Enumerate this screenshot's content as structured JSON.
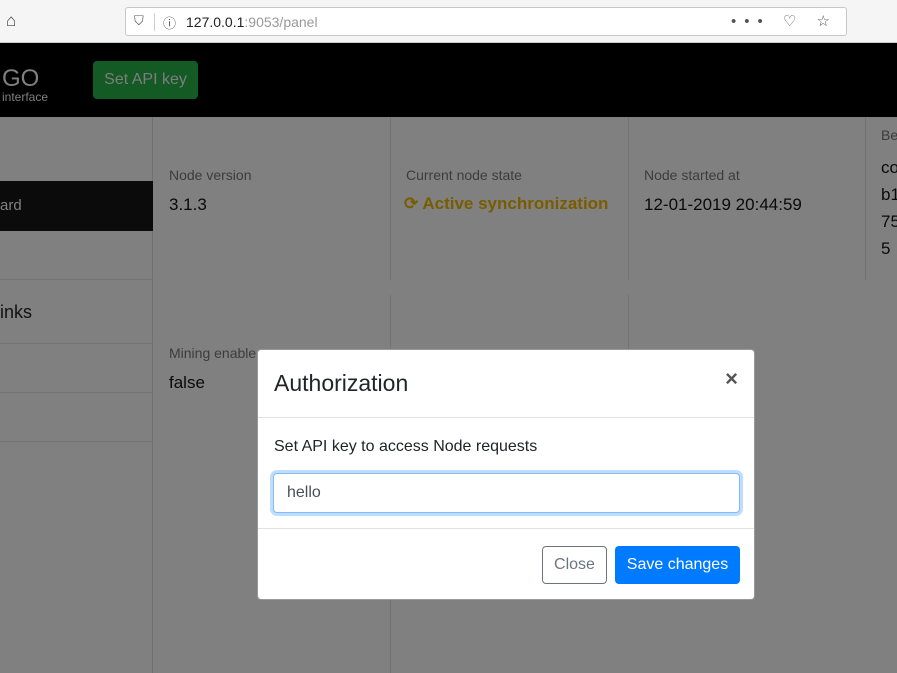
{
  "browser": {
    "url_host": "127.0.0.1",
    "url_rest": ":9053/panel",
    "actions": "••• ♡ ☆"
  },
  "header": {
    "logo": "GO",
    "logo_sub": "interface",
    "api_button": "Set API key"
  },
  "sidebar": {
    "active_item": "ard",
    "links_heading": "inks"
  },
  "stats": [
    {
      "label": "Node version",
      "value": "3.1.3"
    },
    {
      "label": "Current node state",
      "value": "Active synchronization",
      "color": "#7a5c00"
    },
    {
      "label": "Node started at",
      "value": "12-01-2019 20:44:59"
    },
    {
      "label": "Be",
      "value_lines": [
        "co",
        "b1",
        "75",
        "5"
      ]
    },
    {
      "label": "Mining enable",
      "value": "false"
    }
  ],
  "modal": {
    "title": "Authorization",
    "message": "Set API key to access Node requests",
    "input_value": "hello",
    "close_label": "Close",
    "save_label": "Save changes"
  }
}
